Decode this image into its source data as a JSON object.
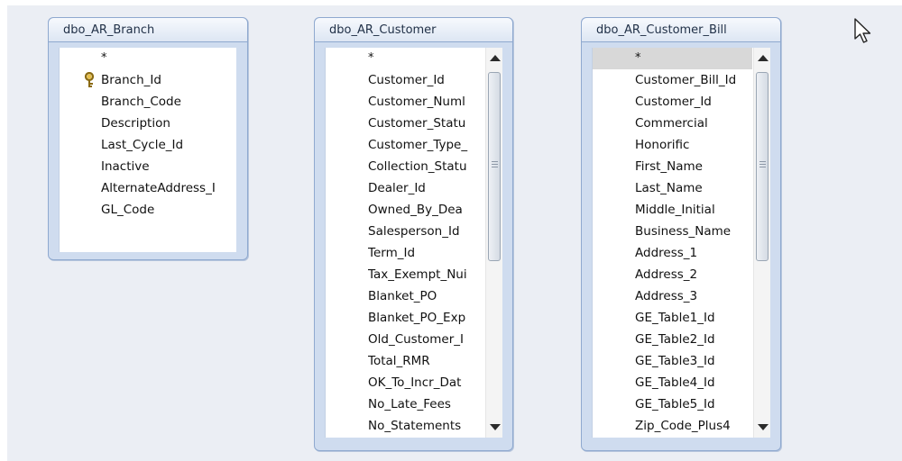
{
  "tables": [
    {
      "title": "dbo_AR_Branch",
      "fields": [
        "*",
        "Branch_Id",
        "Branch_Code",
        "Description",
        "Last_Cycle_Id",
        "Inactive",
        "AlternateAddress_I",
        "GL_Code"
      ],
      "primary_key": "Branch_Id"
    },
    {
      "title": "dbo_AR_Customer",
      "fields": [
        "*",
        "Customer_Id",
        "Customer_Numl",
        "Customer_Statu",
        "Customer_Type_",
        "Collection_Statu",
        "Dealer_Id",
        "Owned_By_Dea",
        "Salesperson_Id",
        "Term_Id",
        "Tax_Exempt_Nui",
        "Blanket_PO",
        "Blanket_PO_Exp",
        "Old_Customer_I",
        "Total_RMR",
        "OK_To_Incr_Dat",
        "No_Late_Fees",
        "No_Statements"
      ]
    },
    {
      "title": "dbo_AR_Customer_Bill",
      "fields": [
        "*",
        "Customer_Bill_Id",
        "Customer_Id",
        "Commercial",
        "Honorific",
        "First_Name",
        "Last_Name",
        "Middle_Initial",
        "Business_Name",
        "Address_1",
        "Address_2",
        "Address_3",
        "GE_Table1_Id",
        "GE_Table2_Id",
        "GE_Table3_Id",
        "GE_Table4_Id",
        "GE_Table5_Id",
        "Zip_Code_Plus4"
      ],
      "selected_field": "*"
    }
  ],
  "icons": {
    "primary_key": "key-icon",
    "pointer": "mouse-pointer-icon",
    "scroll_up": "scroll-up-arrow-icon",
    "scroll_down": "scroll-down-arrow-icon"
  },
  "colors": {
    "canvas": "#ebeef4",
    "frame": "#cfdcef",
    "border": "#8fa9cf"
  }
}
